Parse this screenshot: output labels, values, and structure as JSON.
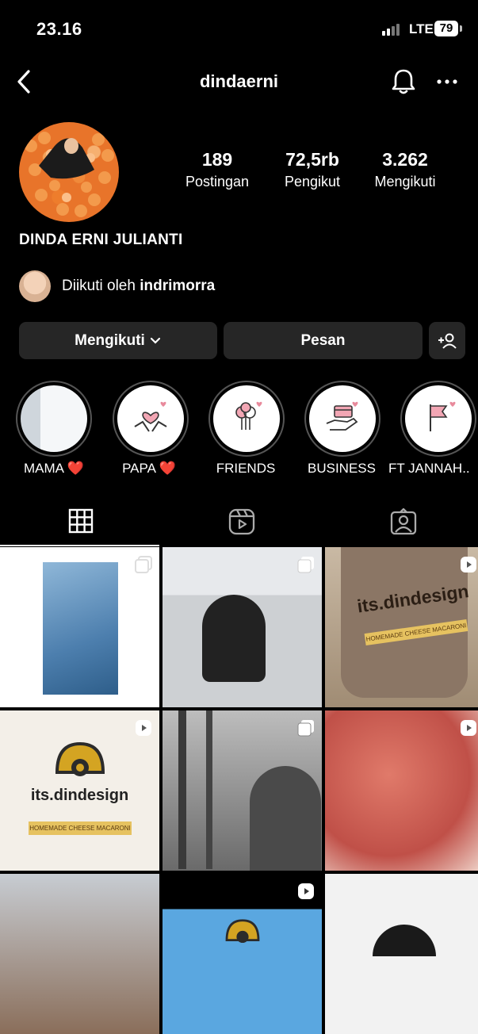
{
  "status": {
    "time": "23.16",
    "network": "LTE",
    "battery": "79"
  },
  "header": {
    "username": "dindaerni"
  },
  "profile": {
    "stats": [
      {
        "value": "189",
        "label": "Postingan"
      },
      {
        "value": "72,5rb",
        "label": "Pengikut"
      },
      {
        "value": "3.262",
        "label": "Mengikuti"
      }
    ],
    "full_name": "DINDA ERNI JULIANTI",
    "followed_by_prefix": "Diikuti oleh",
    "followed_by_user": "indrimorra"
  },
  "actions": {
    "following_label": "Mengikuti",
    "message_label": "Pesan"
  },
  "highlights": [
    {
      "label": "MAMA ❤️"
    },
    {
      "label": "PAPA ❤️"
    },
    {
      "label": "FRIENDS"
    },
    {
      "label": "BUSINESS"
    },
    {
      "label": "FT JANNAH.."
    }
  ],
  "posts": [
    {
      "text": ""
    },
    {
      "text": ""
    },
    {
      "text": "its.dindesign",
      "sub": "HOMEMADE CHEESE MACARONI"
    },
    {
      "text": "its.dindesign",
      "sub": "HOMEMADE CHEESE MACARONI"
    },
    {
      "text": ""
    },
    {
      "text": ""
    }
  ]
}
